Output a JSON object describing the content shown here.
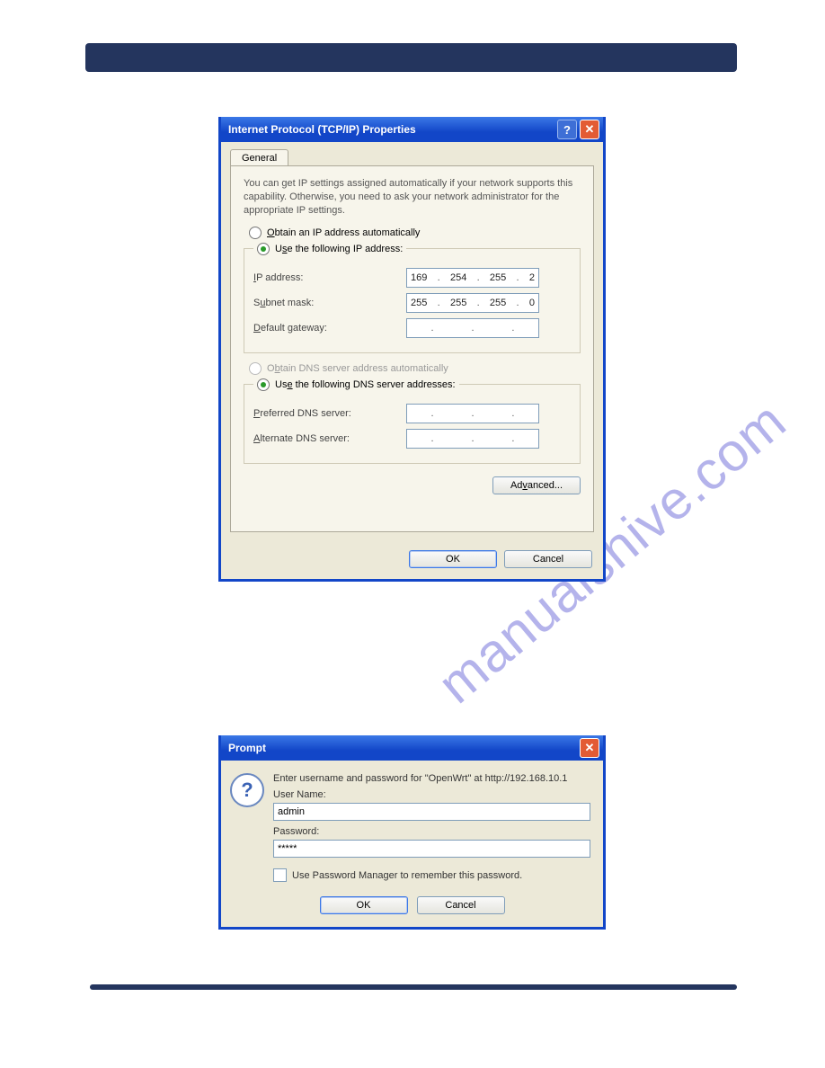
{
  "watermark": "manualshive.com",
  "tcpip": {
    "title": "Internet Protocol (TCP/IP) Properties",
    "tab_general": "General",
    "description": "You can get IP settings assigned automatically if your network supports this capability. Otherwise, you need to ask your network administrator for the appropriate IP settings.",
    "radio_obtain_ip": "Obtain an IP address automatically",
    "radio_use_ip": "Use the following IP address:",
    "label_ip": "IP address:",
    "ip_value": {
      "a": "169",
      "b": "254",
      "c": "255",
      "d": "2"
    },
    "label_subnet": "Subnet mask:",
    "subnet_value": {
      "a": "255",
      "b": "255",
      "c": "255",
      "d": "0"
    },
    "label_gateway": "Default gateway:",
    "radio_obtain_dns": "Obtain DNS server address automatically",
    "radio_use_dns": "Use the following DNS server addresses:",
    "label_pref_dns": "Preferred DNS server:",
    "label_alt_dns": "Alternate DNS server:",
    "btn_advanced": "Advanced...",
    "btn_ok": "OK",
    "btn_cancel": "Cancel"
  },
  "prompt": {
    "title": "Prompt",
    "message": "Enter username and password for \"OpenWrt\" at http://192.168.10.1",
    "label_user": "User Name:",
    "value_user": "admin",
    "label_pass": "Password:",
    "value_pass": "*****",
    "chk_label": "Use Password Manager to remember this password.",
    "btn_ok": "OK",
    "btn_cancel": "Cancel"
  }
}
